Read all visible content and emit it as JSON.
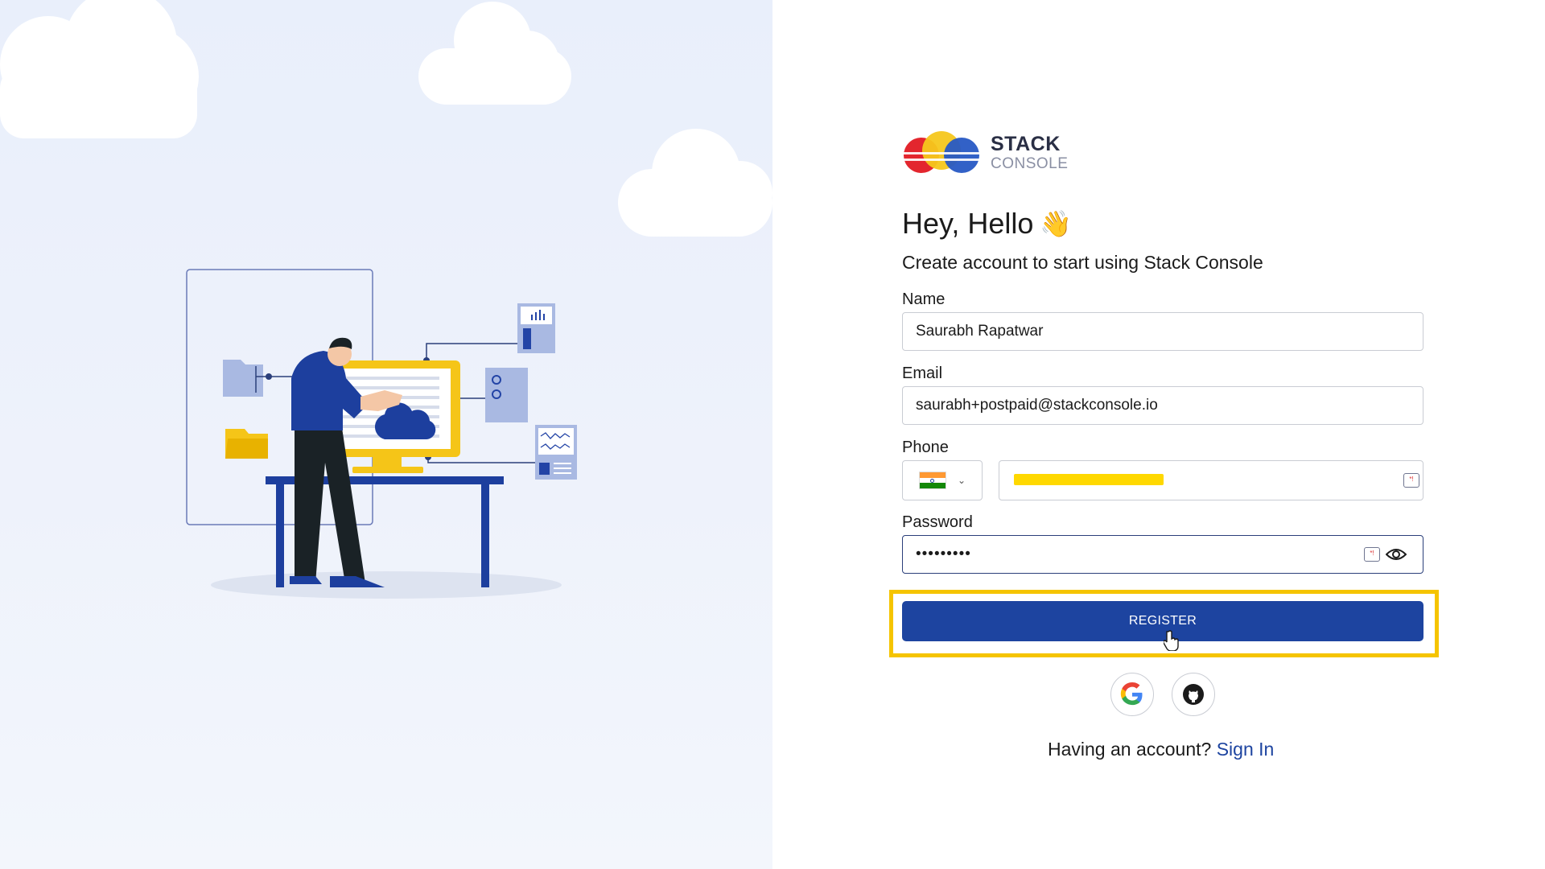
{
  "brand": {
    "name_top": "STACK",
    "name_bottom": "CONSOLE"
  },
  "header": {
    "greeting": "Hey, Hello",
    "wave_emoji": "👋",
    "subtitle": "Create account to start using Stack Console"
  },
  "form": {
    "name": {
      "label": "Name",
      "value": "Saurabh Rapatwar"
    },
    "email": {
      "label": "Email",
      "value": "saurabh+postpaid@stackconsole.io"
    },
    "phone": {
      "label": "Phone",
      "country": "India",
      "value_redacted": true
    },
    "password": {
      "label": "Password",
      "masked_value": "•••••••••"
    },
    "register_label": "REGISTER"
  },
  "social": {
    "google_icon": "google-icon",
    "github_icon": "github-icon"
  },
  "footer": {
    "prompt": "Having an account?",
    "link": "Sign In"
  },
  "colors": {
    "primary": "#1d44a0",
    "highlight": "#f5c400",
    "illustration_blue": "#2344a6",
    "illustration_yellow": "#f5c518",
    "panel_bg": "#eaf0fb"
  }
}
